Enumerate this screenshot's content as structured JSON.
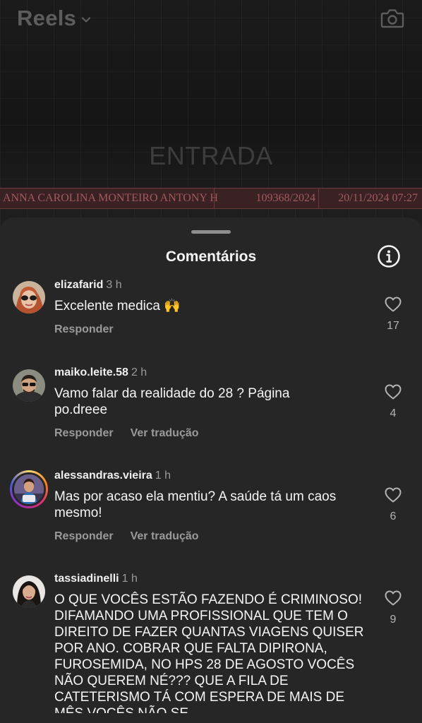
{
  "header": {
    "title": "Reels",
    "chevron_icon": "chevron-down-icon",
    "camera_icon": "camera-icon"
  },
  "reel": {
    "caption": "ENTRADA",
    "strip": {
      "name": "ANNA CAROLINA MONTEIRO ANTONY H",
      "code": "109368/2024",
      "datetime": "20/11/2024 07:27"
    }
  },
  "sheet": {
    "title": "Comentários",
    "info_icon": "info-icon"
  },
  "comments": [
    {
      "username": "elizafarid",
      "time": "3 h",
      "text": "Excelente medica",
      "emoji": "🙌",
      "reply_label": "Responder",
      "translate_label": "",
      "likes": "17"
    },
    {
      "username": "maiko.leite.58",
      "time": "2 h",
      "text": "Vamo falar da realidade do 28 ? Página po.dreee",
      "reply_label": "Responder",
      "translate_label": "Ver tradução",
      "likes": "4"
    },
    {
      "username": "alessandras.vieira",
      "time": "1 h",
      "text": "Mas por acaso ela mentiu? A saúde tá um caos mesmo!",
      "reply_label": "Responder",
      "translate_label": "Ver tradução",
      "likes": "6"
    },
    {
      "username": "tassiadinelli",
      "time": "1 h",
      "text": "O QUE VOCÊS ESTÃO FAZENDO É CRIMINOSO!  DIFAMANDO UMA PROFISSIONAL QUE TEM O DIREITO DE FAZER QUANTAS VIAGENS QUISER POR ANO. COBRAR QUE FALTA DIPIRONA, FUROSEMIDA, NO HPS 28 DE AGOSTO VOCÊS NÃO QUEREM NÉ??? QUE A FILA DE CATETERISMO TÁ COM ESPERA DE MAIS DE MÊS VOCÊS NÃO SE",
      "likes": "9"
    }
  ]
}
